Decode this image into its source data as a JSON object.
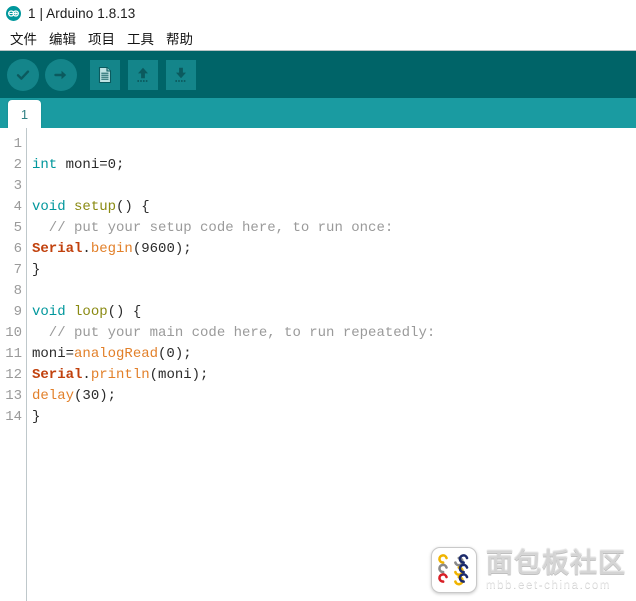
{
  "window": {
    "title": "1 | Arduino 1.8.13",
    "logo_icon": "arduino-infinity-icon"
  },
  "menubar": {
    "items": [
      {
        "label": "文件",
        "name": "file"
      },
      {
        "label": "编辑",
        "name": "edit"
      },
      {
        "label": "项目",
        "name": "sketch"
      },
      {
        "label": "工具",
        "name": "tools"
      },
      {
        "label": "帮助",
        "name": "help"
      }
    ]
  },
  "toolbar": {
    "background": "#006468",
    "button_fill": "#14858a",
    "buttons": [
      {
        "name": "verify-button",
        "icon": "check-circle-icon",
        "shape": "round"
      },
      {
        "name": "upload-button",
        "icon": "arrow-right-circle-icon",
        "shape": "round"
      },
      {
        "name": "new-button",
        "icon": "new-document-icon",
        "shape": "square"
      },
      {
        "name": "open-button",
        "icon": "arrow-up-open-icon",
        "shape": "square"
      },
      {
        "name": "save-button",
        "icon": "arrow-down-save-icon",
        "shape": "square"
      }
    ]
  },
  "tabbar": {
    "background": "#1a9ba1",
    "tabs": [
      {
        "label": "1",
        "active": true
      }
    ]
  },
  "editor": {
    "line_numbers": [
      "1",
      "2",
      "3",
      "4",
      "5",
      "6",
      "7",
      "8",
      "9",
      "10",
      "11",
      "12",
      "13",
      "14"
    ],
    "lines": [
      {
        "n": "1",
        "tokens": []
      },
      {
        "n": "2",
        "tokens": [
          {
            "t": "int",
            "c": "tok-kw"
          },
          {
            "t": " moni=0;",
            "c": "tok-plain"
          }
        ]
      },
      {
        "n": "3",
        "tokens": []
      },
      {
        "n": "4",
        "tokens": [
          {
            "t": "void",
            "c": "tok-kw"
          },
          {
            "t": " ",
            "c": "tok-plain"
          },
          {
            "t": "setup",
            "c": "tok-fn"
          },
          {
            "t": "() {",
            "c": "tok-plain"
          }
        ]
      },
      {
        "n": "5",
        "tokens": [
          {
            "t": "  // put your setup code here, to run once:",
            "c": "tok-cmt"
          }
        ]
      },
      {
        "n": "6",
        "tokens": [
          {
            "t": "Serial",
            "c": "tok-obj"
          },
          {
            "t": ".",
            "c": "tok-plain"
          },
          {
            "t": "begin",
            "c": "tok-call"
          },
          {
            "t": "(9600);",
            "c": "tok-plain"
          }
        ]
      },
      {
        "n": "7",
        "tokens": [
          {
            "t": "}",
            "c": "tok-plain"
          }
        ]
      },
      {
        "n": "8",
        "tokens": []
      },
      {
        "n": "9",
        "tokens": [
          {
            "t": "void",
            "c": "tok-kw"
          },
          {
            "t": " ",
            "c": "tok-plain"
          },
          {
            "t": "loop",
            "c": "tok-fn"
          },
          {
            "t": "() {",
            "c": "tok-plain"
          }
        ]
      },
      {
        "n": "10",
        "tokens": [
          {
            "t": "  // put your main code here, to run repeatedly:",
            "c": "tok-cmt"
          }
        ]
      },
      {
        "n": "11",
        "tokens": [
          {
            "t": "moni=",
            "c": "tok-plain"
          },
          {
            "t": "analogRead",
            "c": "tok-call"
          },
          {
            "t": "(0);",
            "c": "tok-plain"
          }
        ]
      },
      {
        "n": "12",
        "tokens": [
          {
            "t": "Serial",
            "c": "tok-obj"
          },
          {
            "t": ".",
            "c": "tok-plain"
          },
          {
            "t": "println",
            "c": "tok-call"
          },
          {
            "t": "(moni);",
            "c": "tok-plain"
          }
        ]
      },
      {
        "n": "13",
        "tokens": [
          {
            "t": "delay",
            "c": "tok-call"
          },
          {
            "t": "(30);",
            "c": "tok-plain"
          }
        ]
      },
      {
        "n": "14",
        "tokens": [
          {
            "t": "}",
            "c": "tok-plain"
          }
        ]
      }
    ]
  },
  "watermark": {
    "title": "面包板社区",
    "subtitle": "mbb.eet-china.com",
    "logo_icon": "breadboard-community-logo-icon",
    "logo_colors": [
      "#f0b400",
      "#8a8a8a",
      "#1b2a6b",
      "#d81f26"
    ]
  }
}
